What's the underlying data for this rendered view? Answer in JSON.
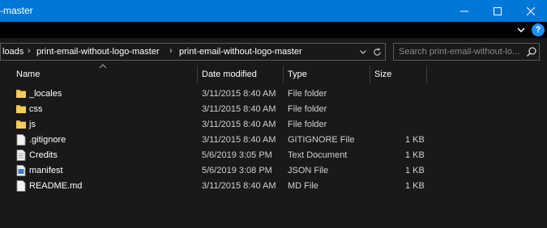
{
  "window": {
    "title": "-master",
    "controls": {
      "minimize": "minimize-icon",
      "maximize": "maximize-icon",
      "close": "close-icon"
    },
    "accent": "#0078d7"
  },
  "ribbon": {
    "help_label": "?"
  },
  "address": {
    "crumbs": [
      "loads",
      "print-email-without-logo-master",
      "print-email-without-logo-master"
    ]
  },
  "search": {
    "placeholder": "Search print-email-without-lo..."
  },
  "columns": [
    "Name",
    "Date modified",
    "Type",
    "Size"
  ],
  "files": [
    {
      "name": "_locales",
      "date": "3/11/2015 8:40 AM",
      "type": "File folder",
      "size": "",
      "icon": "folder-icon"
    },
    {
      "name": "css",
      "date": "3/11/2015 8:40 AM",
      "type": "File folder",
      "size": "",
      "icon": "folder-icon"
    },
    {
      "name": "js",
      "date": "3/11/2015 8:40 AM",
      "type": "File folder",
      "size": "",
      "icon": "folder-icon"
    },
    {
      "name": ".gitignore",
      "date": "3/11/2015 8:40 AM",
      "type": "GITIGNORE File",
      "size": "1 KB",
      "icon": "file-icon"
    },
    {
      "name": "Credits",
      "date": "5/6/2019 3:05 PM",
      "type": "Text Document",
      "size": "1 KB",
      "icon": "text-document-icon"
    },
    {
      "name": "manifest",
      "date": "5/6/2019 3:08 PM",
      "type": "JSON File",
      "size": "1 KB",
      "icon": "json-file-icon"
    },
    {
      "name": "README.md",
      "date": "3/11/2015 8:40 AM",
      "type": "MD File",
      "size": "1 KB",
      "icon": "file-icon"
    }
  ]
}
